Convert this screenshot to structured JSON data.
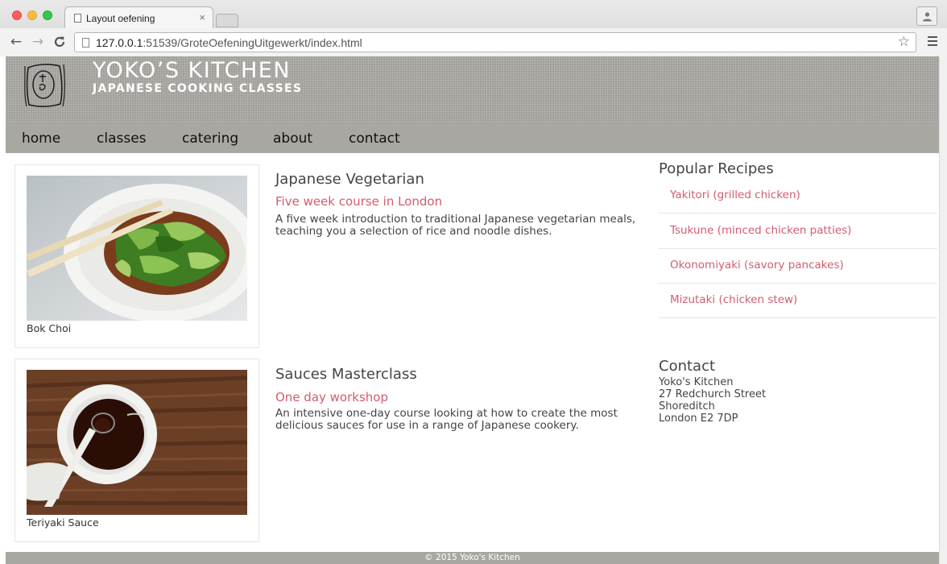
{
  "browser": {
    "tab_title": "Layout oefening",
    "tab_close": "×",
    "url_host": "127.0.0.1",
    "url_rest": ":51539/GroteOefeningUitgewerkt/index.html",
    "back": "←",
    "forward": "→",
    "reload": "C",
    "star": "☆"
  },
  "site": {
    "title": "YOKO’S KITCHEN",
    "subtitle": "JAPANESE COOKING CLASSES"
  },
  "nav": {
    "items": [
      {
        "label": "home"
      },
      {
        "label": "classes"
      },
      {
        "label": "catering"
      },
      {
        "label": "about"
      },
      {
        "label": "contact"
      }
    ]
  },
  "courses": [
    {
      "caption": "Bok Choi",
      "title": "Japanese Vegetarian",
      "subtitle": "Five week course in London",
      "desc_line1": "A five week introduction to traditional Japanese vegetarian meals,",
      "desc_line2": "teaching you a selection of rice and noodle dishes."
    },
    {
      "caption": "Teriyaki Sauce",
      "title": "Sauces Masterclass",
      "subtitle": "One day workshop",
      "desc_line1": "An intensive one-day course looking at how to create the most",
      "desc_line2": "delicious sauces for use in a range of Japanese cookery."
    }
  ],
  "sidebar": {
    "recipes_heading": "Popular Recipes",
    "recipes": [
      {
        "label": "Yakitori (grilled chicken)"
      },
      {
        "label": "Tsukune (minced chicken patties)"
      },
      {
        "label": "Okonomiyaki (savory pancakes)"
      },
      {
        "label": "Mizutaki (chicken stew)"
      }
    ],
    "contact_heading": "Contact",
    "contact_lines": [
      "Yoko's Kitchen",
      "27 Redchurch Street",
      "Shoreditch",
      "London E2 7DP"
    ]
  },
  "footer": {
    "text": "© 2015 Yoko's Kitchen"
  },
  "colors": {
    "accent_link": "#d35d6e",
    "nav_bg": "#a9a7a2",
    "header_bg": "#b0aea9"
  }
}
